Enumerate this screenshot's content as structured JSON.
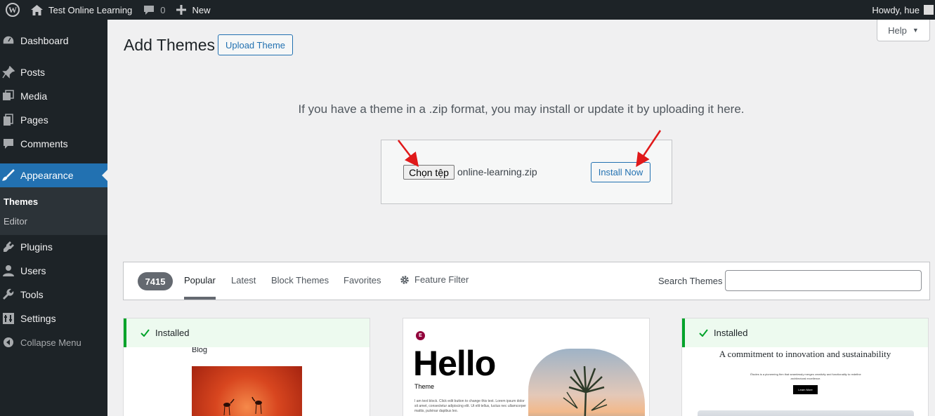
{
  "admin_bar": {
    "site_name": "Test Online Learning",
    "comments_count": "0",
    "new_label": "New",
    "howdy": "Howdy, hue"
  },
  "sidebar": {
    "items": [
      {
        "label": "Dashboard",
        "icon": "dashboard-icon"
      },
      {
        "label": "Posts",
        "icon": "pin-icon"
      },
      {
        "label": "Media",
        "icon": "media-icon"
      },
      {
        "label": "Pages",
        "icon": "pages-icon"
      },
      {
        "label": "Comments",
        "icon": "comment-icon"
      },
      {
        "label": "Appearance",
        "icon": "paintbrush-icon"
      },
      {
        "label": "Plugins",
        "icon": "plugin-icon"
      },
      {
        "label": "Users",
        "icon": "users-icon"
      },
      {
        "label": "Tools",
        "icon": "wrench-icon"
      },
      {
        "label": "Settings",
        "icon": "settings-icon"
      }
    ],
    "submenu": [
      "Themes",
      "Editor"
    ],
    "collapse_label": "Collapse Menu"
  },
  "page": {
    "title": "Add Themes",
    "upload_button": "Upload Theme",
    "help_label": "Help"
  },
  "upload": {
    "description": "If you have a theme in a .zip format, you may install or update it by uploading it here.",
    "choose_file": "Chọn tệp",
    "file_name": "online-learning.zip",
    "install_button": "Install Now"
  },
  "filter": {
    "count": "7415",
    "tabs": [
      "Popular",
      "Latest",
      "Block Themes",
      "Favorites"
    ],
    "feature_filter": "Feature Filter",
    "search_label": "Search Themes",
    "search_value": ""
  },
  "themes": {
    "installed_label": "Installed",
    "card1_blog": "Blog",
    "card2_title": "Hello",
    "card2_subtitle": "Theme",
    "card2_text": "I am text block. Click edit button to change this text. Lorem ipsum dolor sit amet, consectetur adipiscing elit. Ut elit tellus, luctus nec ullamcorper mattis, pulvinar dapibus leo.",
    "card3_headline": "A commitment to innovation and sustainability",
    "card3_body": "Études is a pioneering firm that seamlessly merges creativity and functionality to redefine architectural excellence.",
    "card3_button": "Learn More"
  },
  "colors": {
    "admin_dark": "#1d2327",
    "accent": "#2271b1",
    "installed_green": "#00a32a",
    "annotation_red": "#e0191a"
  }
}
